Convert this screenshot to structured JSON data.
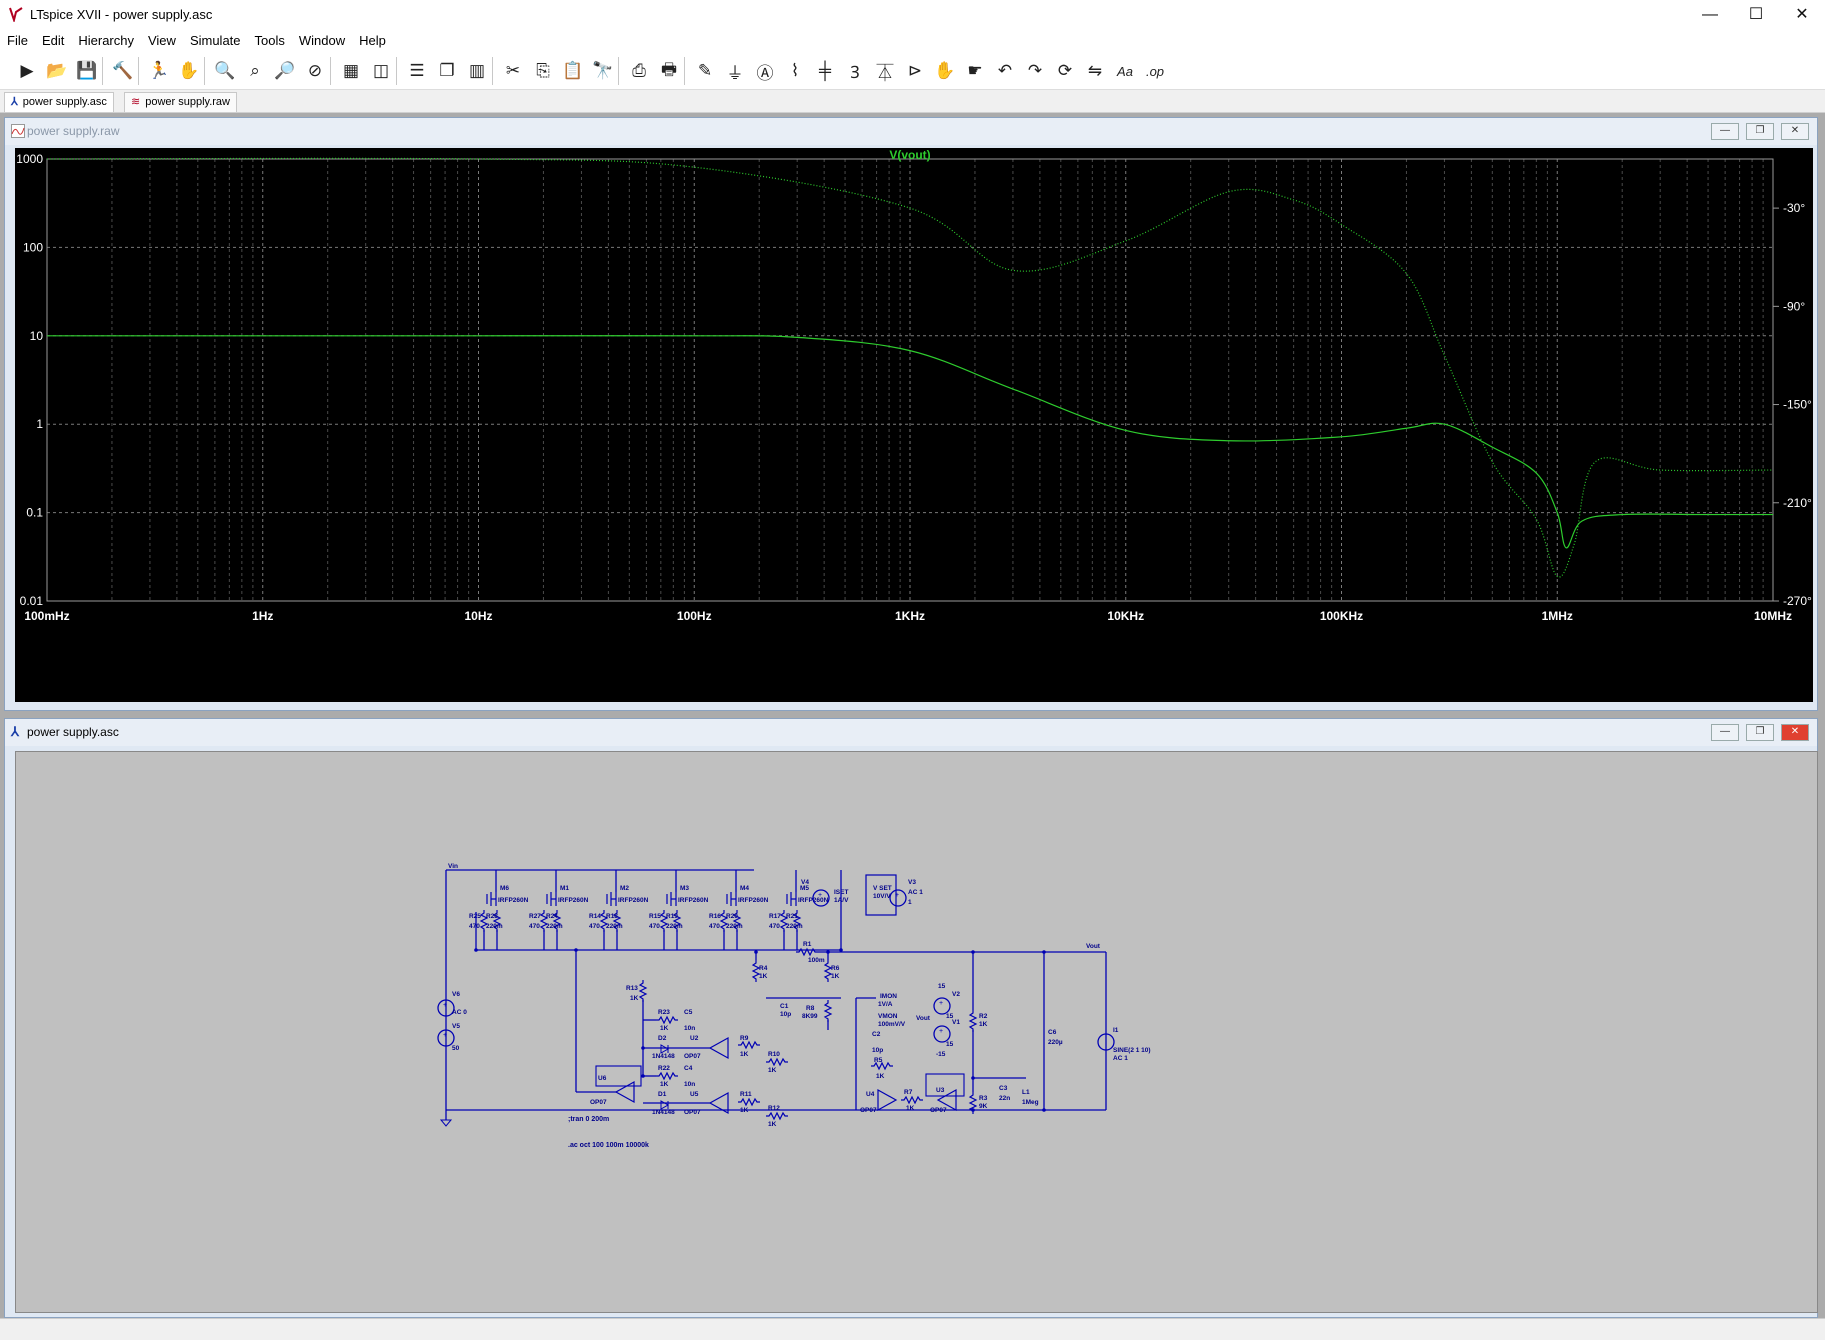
{
  "window": {
    "title": "LTspice XVII - power supply.asc",
    "minimize": "—",
    "maximize": "☐",
    "close": "✕"
  },
  "menu": [
    "File",
    "Edit",
    "Hierarchy",
    "View",
    "Simulate",
    "Tools",
    "Window",
    "Help"
  ],
  "toolbar_icons": [
    "run-icon",
    "open-icon",
    "save-icon",
    "control-panel-icon",
    "halt-icon",
    "pan-hand-icon",
    "zoom-in-icon",
    "zoom-full-icon",
    "zoom-out-icon",
    "zoom-cancel-icon",
    "autorange-icon",
    "plot-settings-icon",
    "tile-horizontal-icon",
    "cascade-icon",
    "tile-vertical-icon",
    "cut-icon",
    "copy-icon",
    "paste-icon",
    "find-icon",
    "print-icon",
    "print-setup-icon",
    "draw-wire-icon",
    "ground-icon",
    "label-net-icon",
    "resistor-icon",
    "capacitor-icon",
    "inductor-icon",
    "diode-icon",
    "component-icon",
    "move-icon",
    "drag-icon",
    "undo-icon",
    "redo-icon",
    "rotate-icon",
    "mirror-icon",
    "text-icon",
    "spice-directive-icon"
  ],
  "tabs": [
    {
      "label": "power supply.asc",
      "active": true
    },
    {
      "label": "power supply.raw",
      "active": false
    }
  ],
  "waveform_window": {
    "title": "power supply.raw",
    "trace_label": "V(vout)",
    "trace_color": "#2ecc2e",
    "y_ticks": [
      "1000",
      "100",
      "10",
      "1",
      "0.1",
      "0.01"
    ],
    "y2_ticks": [
      "-30°",
      "-90°",
      "-150°",
      "-210°",
      "-270°"
    ],
    "x_ticks": [
      "100mHz",
      "1Hz",
      "10Hz",
      "100Hz",
      "1KHz",
      "10KHz",
      "100KHz",
      "1MHz",
      "10MHz"
    ]
  },
  "chart_data": {
    "type": "line",
    "title": "V(vout)",
    "x_scale": "log",
    "y_scale": "log",
    "xlim": [
      0.1,
      10000000
    ],
    "ylim": [
      0.01,
      1000
    ],
    "y2lim": [
      -270,
      0
    ],
    "series": [
      {
        "name": "V(vout)",
        "style": "solid",
        "axis": "left",
        "x": [
          0.1,
          1,
          10,
          100,
          300,
          1000,
          3000,
          10000,
          30000,
          100000,
          200000,
          300000,
          500000,
          800000,
          1000000,
          1100000,
          1300000,
          2000000,
          5000000,
          10000000
        ],
        "values": [
          10,
          10,
          10,
          10,
          9.6,
          6.8,
          2.5,
          0.85,
          0.65,
          0.72,
          0.9,
          1.0,
          0.55,
          0.28,
          0.1,
          0.04,
          0.08,
          0.095,
          0.095,
          0.095
        ]
      },
      {
        "name": "phase",
        "style": "dotted",
        "axis": "right",
        "x": [
          0.1,
          10,
          100,
          1000,
          3000,
          10000,
          30000,
          60000,
          100000,
          200000,
          300000,
          500000,
          800000,
          1000000,
          1200000,
          1500000,
          3000000,
          10000000
        ],
        "values": [
          0,
          0,
          -5,
          -30,
          -68,
          -50,
          -20,
          -25,
          -40,
          -70,
          -120,
          -185,
          -220,
          -255,
          -235,
          -185,
          -190,
          -190
        ]
      }
    ]
  },
  "schematic_window": {
    "title": "power supply.asc",
    "labels": {
      "vin": "Vin",
      "vout": "Vout",
      "tran": ";tran 0 200m",
      "ac": ".ac oct 100 100m 10000k",
      "m_parts": [
        "M6",
        "M1",
        "M2",
        "M3",
        "M4",
        "M5"
      ],
      "mosfet_model": "IRFP260N",
      "r_top": [
        "R25",
        "R28",
        "R27",
        "R24",
        "R14",
        "R18",
        "R15",
        "R19",
        "R16",
        "R20",
        "R17",
        "R21"
      ],
      "r_top_vals": [
        "470",
        "220m"
      ],
      "v4": "V4",
      "iset": "ISET",
      "iset2": "1A/V",
      "v3": "V3",
      "vset": "V SET",
      "vset2": "10V/V",
      "ac1": "AC 1",
      "one": "1",
      "r1": "R1",
      "r1v": "100m",
      "r4": "R4",
      "r5": "R5",
      "r6": "R6",
      "r13": "R13",
      "k1": "1K",
      "c1": "C1",
      "c1v": "10p",
      "r8": "R8",
      "r8v": "8K99",
      "imon": "IMON",
      "imon2": "1V/A",
      "vmon": "VMON",
      "vmon2": "100mV/V",
      "v2": "V2",
      "v1": "V1",
      "fifteen": "15",
      "minus15": "-15",
      "r2": "R2",
      "r3": "R3",
      "r3v": "9K",
      "v6": "V6",
      "ac0": "AC 0",
      "v5": "V5",
      "v5v": "50",
      "r23": "R23",
      "c5": "C5",
      "c5v": "10n",
      "d2": "D2",
      "diode": "1N4148",
      "u2": "U2",
      "opamp": "OP07",
      "r9": "R9",
      "r10": "R10",
      "u6": "U6",
      "r22": "R22",
      "c4": "C4",
      "d1": "D1",
      "u5": "U5",
      "r11": "R11",
      "r12": "R12",
      "c2": "C2",
      "r7": "R7",
      "u4": "U4",
      "u3": "U3",
      "c3": "C3",
      "c3v": "22n",
      "l1": "L1",
      "l1v": "1Meg",
      "c6": "C6",
      "c6v": "220µ",
      "i1": "I1",
      "i1v": "SINE(2 1 10)",
      "i1ac": "AC 1"
    }
  }
}
